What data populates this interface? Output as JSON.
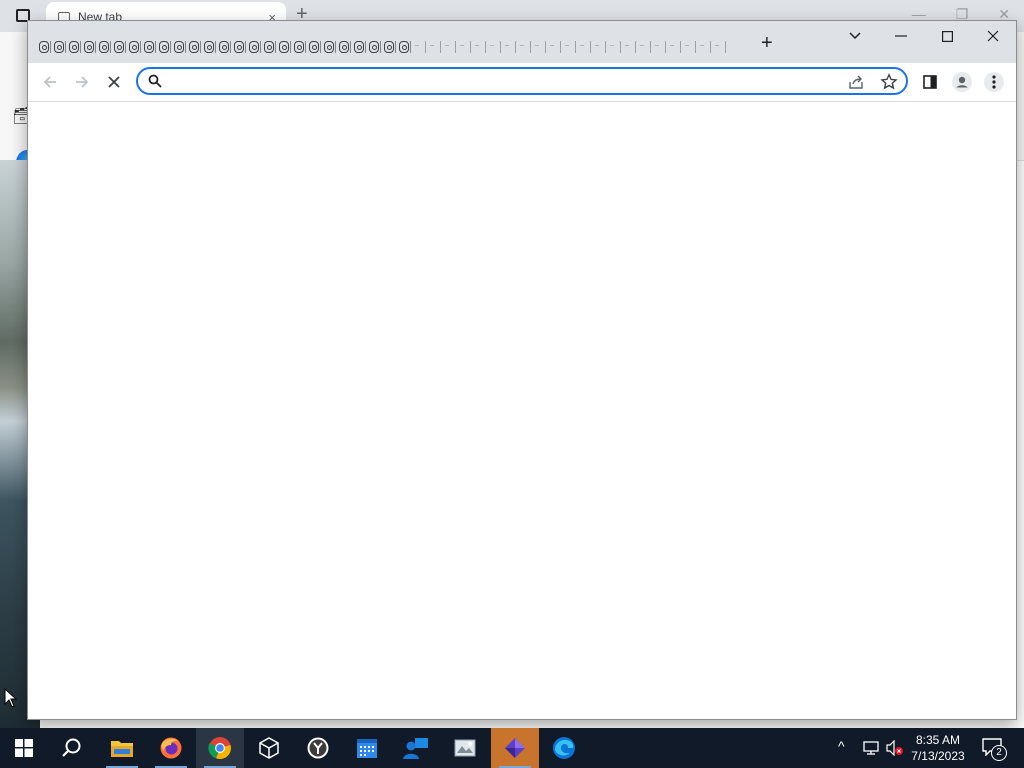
{
  "background_browser": {
    "tab_title": "New tab",
    "tab_close": "×",
    "new_tab": "+"
  },
  "chrome": {
    "tabs": {
      "pinned_count": 25,
      "ghost_count": 21,
      "icon": "globe-tab-icon"
    },
    "new_tab_label": "+",
    "window_controls": [
      "chevron-down-icon",
      "minimize-icon",
      "maximize-icon",
      "close-icon"
    ],
    "toolbar": {
      "back_icon": "back-arrow-icon",
      "forward_icon": "forward-arrow-icon",
      "stop_icon": "stop-loading-icon",
      "omnibox_value": "",
      "omnibox_placeholder": "",
      "share_icon": "share-icon",
      "bookmark_icon": "star-icon",
      "side_panel_icon": "side-panel-icon",
      "profile_icon": "profile-icon",
      "menu_icon": "kebab-menu-icon"
    },
    "accent_color": "#1a73e8"
  },
  "taskbar": {
    "apps": [
      {
        "name": "start",
        "icon": "windows-logo-icon"
      },
      {
        "name": "search",
        "icon": "search-icon"
      },
      {
        "name": "file-explorer",
        "icon": "folder-icon"
      },
      {
        "name": "firefox",
        "icon": "firefox-icon"
      },
      {
        "name": "chrome",
        "icon": "chrome-icon"
      },
      {
        "name": "3d-viewer",
        "icon": "cube-icon"
      },
      {
        "name": "alarms",
        "icon": "clock-icon"
      },
      {
        "name": "calendar",
        "icon": "calendar-icon"
      },
      {
        "name": "people",
        "icon": "people-icon"
      },
      {
        "name": "photos",
        "icon": "photos-icon"
      },
      {
        "name": "clipchamp",
        "icon": "clipchamp-icon"
      },
      {
        "name": "edge",
        "icon": "edge-icon"
      }
    ],
    "tray": {
      "chevron": "^",
      "time": "8:35 AM",
      "date": "7/13/2023",
      "notification_count": "2"
    }
  }
}
